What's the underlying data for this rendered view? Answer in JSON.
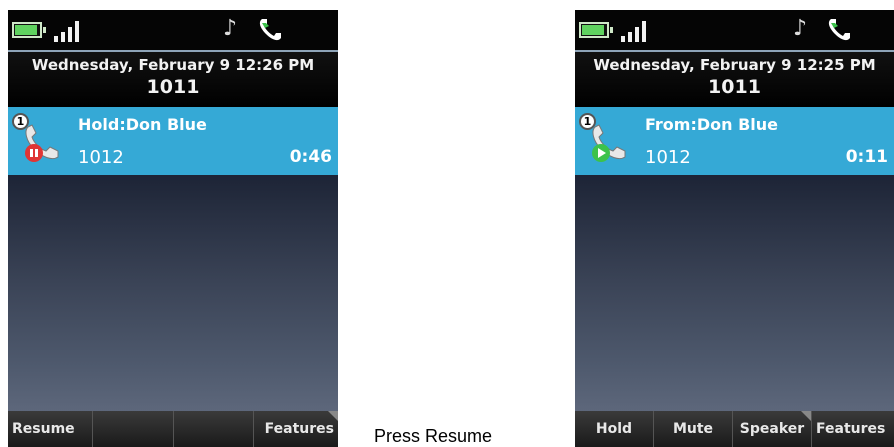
{
  "left_phone": {
    "date": "Wednesday, February 9 12:26 PM",
    "extension": "1011",
    "call": {
      "index": "1",
      "status": "Hold:Don Blue",
      "number": "1012",
      "timer": "0:46",
      "icon": "call-hold-icon"
    },
    "softkeys": [
      "Resume",
      "",
      "",
      "Features"
    ]
  },
  "right_phone": {
    "date": "Wednesday, February 9 12:25 PM",
    "extension": "1011",
    "call": {
      "index": "1",
      "status": "From:Don Blue",
      "number": "1012",
      "timer": "0:11",
      "icon": "call-active-icon"
    },
    "softkeys": [
      "Hold",
      "Mute",
      "Speaker",
      "Features"
    ]
  },
  "caption": "Press Resume",
  "colors": {
    "call_row": "#35a9d6",
    "battery": "#5fd35f",
    "hold_indicator": "#e03535",
    "active_indicator": "#3cc24b"
  },
  "icons": [
    "battery-icon",
    "signal-icon",
    "music-note-icon",
    "handset-icon"
  ]
}
